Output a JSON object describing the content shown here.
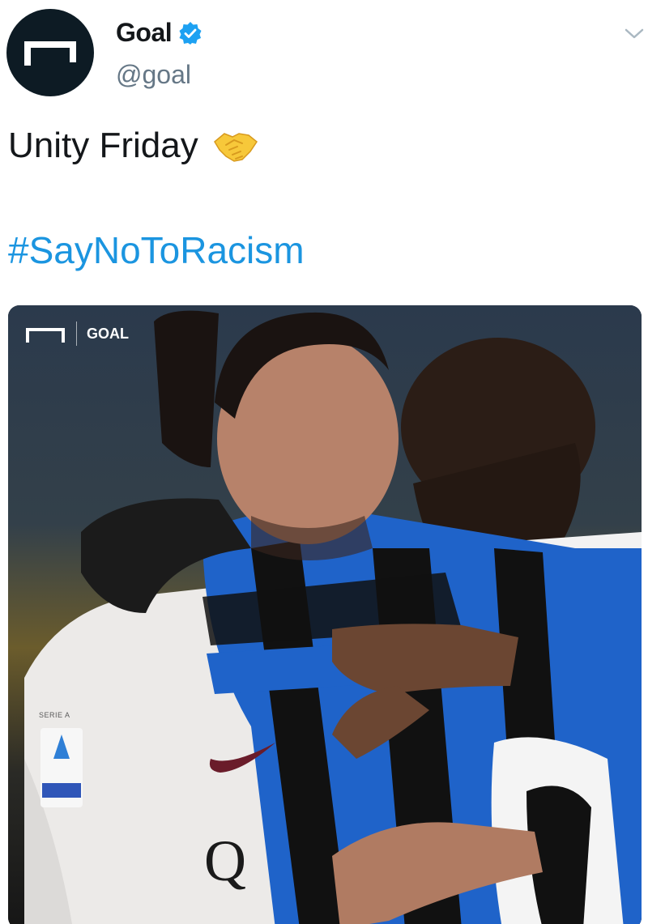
{
  "account": {
    "display_name": "Goal",
    "handle": "@goal",
    "verified": true,
    "avatar_icon": "goal-logo-icon"
  },
  "menu": {
    "icon": "chevron-down-icon"
  },
  "tweet": {
    "text": "Unity Friday",
    "emoji": "handshake-emoji",
    "hashtag": "#SayNoToRacism"
  },
  "media": {
    "watermark_text": "GOAL",
    "badge_text": "SERIE A",
    "shirt_letter": "Q"
  },
  "colors": {
    "link": "#1b95e0",
    "verified": "#1da1f2",
    "avatar_bg": "#0d1b24",
    "handle": "#657786",
    "inter_blue": "#1f63c9",
    "inter_black": "#111111"
  }
}
